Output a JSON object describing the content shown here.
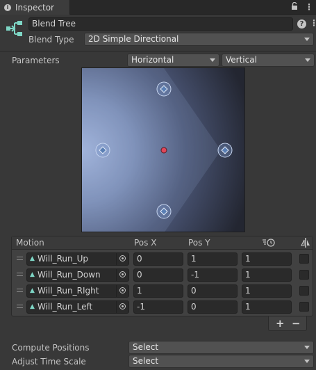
{
  "tab": {
    "title": "Inspector",
    "icon": "info-icon"
  },
  "header": {
    "name_value": "Blend Tree",
    "blend_type_label": "Blend Type",
    "blend_type_value": "2D Simple Directional",
    "help": "?",
    "menu": "⋮"
  },
  "parameters": {
    "label": "Parameters",
    "x_param": "Horizontal",
    "y_param": "Vertical"
  },
  "graph": {
    "colors": {
      "highlight": "#9fb1d8",
      "background": "#20232c",
      "point": "#5a7fb4",
      "center": "#e0475a"
    },
    "points": [
      {
        "name": "Will_Run_Up",
        "x": 0,
        "y": 1
      },
      {
        "name": "Will_Run_Down",
        "x": 0,
        "y": -1
      },
      {
        "name": "Will_Run_Right",
        "x": 1,
        "y": 0
      },
      {
        "name": "Will_Run_Left",
        "x": -1,
        "y": 0
      }
    ]
  },
  "table": {
    "headers": {
      "motion": "Motion",
      "pos_x": "Pos X",
      "pos_y": "Pos Y"
    },
    "rows": [
      {
        "motion": "Will_Run_Up",
        "pos_x": "0",
        "pos_y": "1",
        "speed": "1"
      },
      {
        "motion": "Will_Run_Down",
        "pos_x": "0",
        "pos_y": "-1",
        "speed": "1"
      },
      {
        "motion": "Will_Run_RIght",
        "pos_x": "1",
        "pos_y": "0",
        "speed": "1"
      },
      {
        "motion": "Will_Run_Left",
        "pos_x": "-1",
        "pos_y": "0",
        "speed": "1"
      }
    ],
    "add": "+",
    "remove": "−"
  },
  "footer": {
    "compute_label": "Compute Positions",
    "compute_value": "Select",
    "adjust_label": "Adjust Time Scale",
    "adjust_value": "Select"
  }
}
